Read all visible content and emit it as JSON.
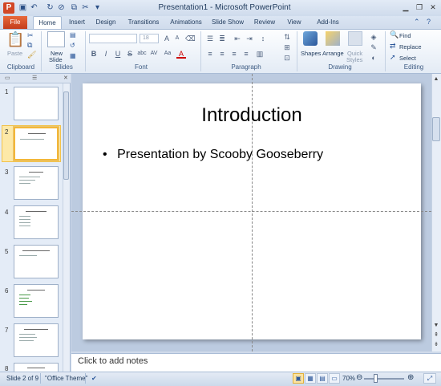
{
  "window": {
    "title": "Presentation1 - Microsoft PowerPoint",
    "app_icon": "P"
  },
  "qat": {
    "save_icon": "save-icon",
    "undo_icon": "undo-icon",
    "redo_icon": "redo-icon",
    "customize_icon": "customize-qat-icon"
  },
  "tabs": [
    {
      "label": "File"
    },
    {
      "label": "Home"
    },
    {
      "label": "Insert"
    },
    {
      "label": "Design"
    },
    {
      "label": "Transitions"
    },
    {
      "label": "Animations"
    },
    {
      "label": "Slide Show"
    },
    {
      "label": "Review"
    },
    {
      "label": "View"
    },
    {
      "label": "Add-Ins"
    }
  ],
  "ribbon": {
    "groups": {
      "clipboard": "Clipboard",
      "slides": "Slides",
      "font": "Font",
      "paragraph": "Paragraph",
      "drawing": "Drawing",
      "editing": "Editing"
    },
    "paste_label": "Paste",
    "new_slide_label_1": "New",
    "new_slide_label_2": "Slide",
    "font_size": "18",
    "shapes_label": "Shapes",
    "arrange_label": "Arrange",
    "quick_styles_label_1": "Quick",
    "quick_styles_label_2": "Styles",
    "find_label": "Find",
    "replace_label": "Replace",
    "select_label": "Select"
  },
  "slides_panel": {
    "numbers": [
      "1",
      "2",
      "3",
      "4",
      "5",
      "6",
      "7",
      "8"
    ],
    "selected_index": 2
  },
  "slide": {
    "title": "Introduction",
    "bullet": "Presentation by Scooby Gooseberry"
  },
  "notes": {
    "placeholder": "Click to add notes"
  },
  "status": {
    "slide_info": "Slide 2 of 9",
    "theme": "\"Office Theme\"",
    "zoom": "70%"
  },
  "colors": {
    "file_tab": "#d24726",
    "selection": "#f3b73a",
    "ribbon_bg": "#dfe8f5"
  }
}
